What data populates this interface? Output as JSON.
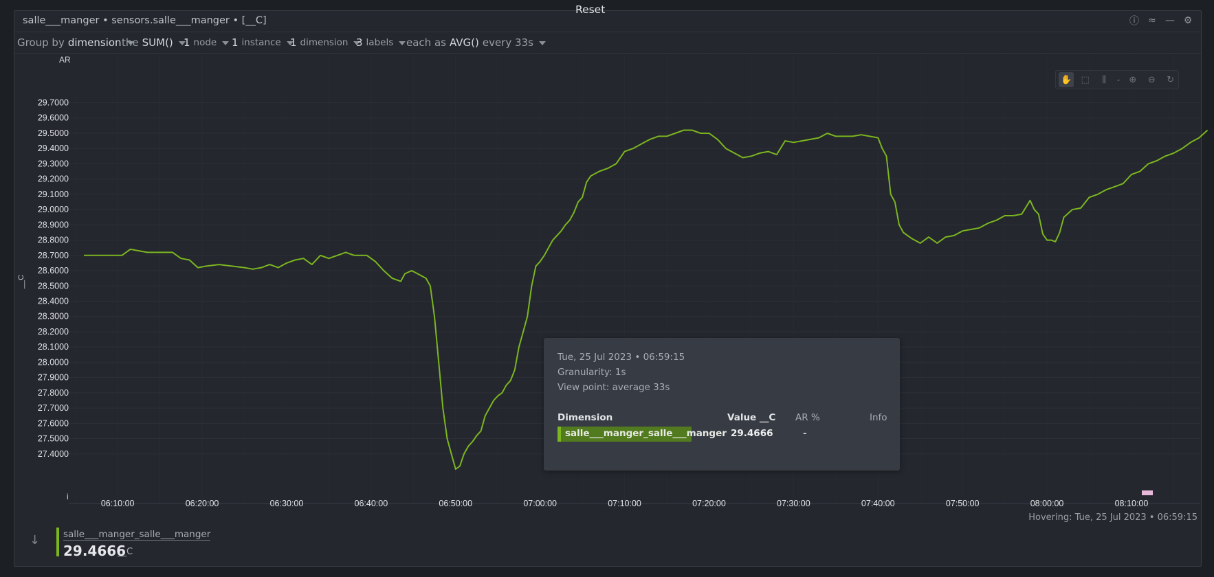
{
  "header": {
    "title": "salle___manger • sensors.salle___manger • [__C]",
    "icons": [
      "info-icon",
      "correlation-icon",
      "minimize-icon",
      "settings-icon"
    ]
  },
  "controls": {
    "group_by": {
      "prefix": "Group by",
      "value": "dimension"
    },
    "aggregate": {
      "prefix": "the",
      "value": "SUM()"
    },
    "nodes": {
      "count": "1",
      "label": "node"
    },
    "instances": {
      "count": "1",
      "label": "instance"
    },
    "dimensions": {
      "count": "1",
      "label": "dimension"
    },
    "labels": {
      "count": "3",
      "label": "labels"
    },
    "time_agg": {
      "prefix": "each as",
      "value": "AVG()",
      "suffix": "every 33s"
    },
    "reset_label": "Reset"
  },
  "chart_data": {
    "type": "line",
    "ylabel": "__C",
    "top_left_label": "AR",
    "bottom_left_label": "i",
    "ylim": [
      27.2,
      29.8
    ],
    "y_ticks": [
      "29.7000",
      "29.6000",
      "29.5000",
      "29.4000",
      "29.3000",
      "29.2000",
      "29.1000",
      "29.0000",
      "28.9000",
      "28.8000",
      "28.7000",
      "28.6000",
      "28.5000",
      "28.4000",
      "28.3000",
      "28.2000",
      "28.1000",
      "28.0000",
      "27.9000",
      "27.8000",
      "27.7000",
      "27.6000",
      "27.5000",
      "27.4000"
    ],
    "x_ticks": [
      "06:10:00",
      "06:20:00",
      "06:30:00",
      "06:40:00",
      "06:50:00",
      "07:00:00",
      "07:10:00",
      "07:20:00",
      "07:30:00",
      "07:40:00",
      "07:50:00",
      "08:00:00",
      "08:10:00"
    ],
    "x_range_minutes": [
      6.0,
      138.0
    ],
    "series": [
      {
        "name": "salle___manger_salle___manger",
        "color": "#7cb61f",
        "points": [
          [
            6.0,
            28.7
          ],
          [
            8.0,
            28.7
          ],
          [
            10.5,
            28.7
          ],
          [
            11.5,
            28.74
          ],
          [
            12.5,
            28.73
          ],
          [
            13.5,
            28.72
          ],
          [
            15.0,
            28.72
          ],
          [
            16.5,
            28.72
          ],
          [
            17.5,
            28.68
          ],
          [
            18.5,
            28.67
          ],
          [
            19.5,
            28.62
          ],
          [
            20.5,
            28.63
          ],
          [
            22.0,
            28.64
          ],
          [
            23.5,
            28.63
          ],
          [
            25.0,
            28.62
          ],
          [
            26.0,
            28.61
          ],
          [
            27.0,
            28.62
          ],
          [
            28.0,
            28.64
          ],
          [
            29.0,
            28.62
          ],
          [
            30.0,
            28.65
          ],
          [
            31.0,
            28.67
          ],
          [
            32.0,
            28.68
          ],
          [
            33.0,
            28.64
          ],
          [
            34.0,
            28.7
          ],
          [
            35.0,
            28.68
          ],
          [
            36.0,
            28.7
          ],
          [
            37.0,
            28.72
          ],
          [
            38.0,
            28.7
          ],
          [
            39.5,
            28.7
          ],
          [
            40.5,
            28.66
          ],
          [
            41.5,
            28.6
          ],
          [
            42.5,
            28.55
          ],
          [
            43.5,
            28.53
          ],
          [
            44.0,
            28.58
          ],
          [
            44.8,
            28.6
          ],
          [
            45.5,
            28.58
          ],
          [
            46.5,
            28.55
          ],
          [
            47.0,
            28.5
          ],
          [
            47.5,
            28.3
          ],
          [
            48.0,
            28.0
          ],
          [
            48.5,
            27.7
          ],
          [
            49.0,
            27.5
          ],
          [
            49.5,
            27.4
          ],
          [
            50.0,
            27.3
          ],
          [
            50.5,
            27.32
          ],
          [
            51.0,
            27.4
          ],
          [
            51.5,
            27.45
          ],
          [
            52.0,
            27.48
          ],
          [
            52.5,
            27.52
          ],
          [
            53.0,
            27.55
          ],
          [
            53.5,
            27.65
          ],
          [
            54.0,
            27.7
          ],
          [
            54.5,
            27.75
          ],
          [
            55.0,
            27.78
          ],
          [
            55.5,
            27.8
          ],
          [
            56.0,
            27.85
          ],
          [
            56.5,
            27.88
          ],
          [
            57.0,
            27.95
          ],
          [
            57.5,
            28.1
          ],
          [
            58.0,
            28.2
          ],
          [
            58.5,
            28.3
          ],
          [
            59.0,
            28.5
          ],
          [
            59.5,
            28.63
          ],
          [
            60.0,
            28.66
          ],
          [
            60.5,
            28.7
          ],
          [
            61.0,
            28.75
          ],
          [
            61.5,
            28.8
          ],
          [
            62.0,
            28.83
          ],
          [
            62.5,
            28.86
          ],
          [
            63.0,
            28.9
          ],
          [
            63.5,
            28.93
          ],
          [
            64.0,
            28.98
          ],
          [
            64.5,
            29.05
          ],
          [
            65.0,
            29.08
          ],
          [
            65.5,
            29.18
          ],
          [
            66.0,
            29.22
          ],
          [
            67.0,
            29.25
          ],
          [
            68.0,
            29.27
          ],
          [
            69.0,
            29.3
          ],
          [
            70.0,
            29.38
          ],
          [
            71.0,
            29.4
          ],
          [
            72.0,
            29.43
          ],
          [
            73.0,
            29.46
          ],
          [
            74.0,
            29.48
          ],
          [
            75.0,
            29.48
          ],
          [
            76.0,
            29.5
          ],
          [
            77.0,
            29.52
          ],
          [
            78.0,
            29.52
          ],
          [
            79.0,
            29.5
          ],
          [
            80.0,
            29.5
          ],
          [
            81.0,
            29.46
          ],
          [
            82.0,
            29.4
          ],
          [
            83.0,
            29.37
          ],
          [
            84.0,
            29.34
          ],
          [
            85.0,
            29.35
          ],
          [
            86.0,
            29.37
          ],
          [
            87.0,
            29.38
          ],
          [
            88.0,
            29.36
          ],
          [
            89.0,
            29.45
          ],
          [
            90.0,
            29.44
          ],
          [
            91.0,
            29.45
          ],
          [
            92.0,
            29.46
          ],
          [
            93.0,
            29.47
          ],
          [
            94.0,
            29.5
          ],
          [
            95.0,
            29.48
          ],
          [
            96.0,
            29.48
          ],
          [
            97.0,
            29.48
          ],
          [
            98.0,
            29.49
          ],
          [
            99.0,
            29.48
          ],
          [
            100.0,
            29.47
          ],
          [
            100.5,
            29.4
          ],
          [
            101.0,
            29.35
          ],
          [
            101.5,
            29.1
          ],
          [
            102.0,
            29.05
          ],
          [
            102.5,
            28.9
          ],
          [
            103.0,
            28.85
          ],
          [
            104.0,
            28.81
          ],
          [
            105.0,
            28.78
          ],
          [
            106.0,
            28.82
          ],
          [
            107.0,
            28.78
          ],
          [
            108.0,
            28.82
          ],
          [
            109.0,
            28.83
          ],
          [
            110.0,
            28.86
          ],
          [
            111.0,
            28.87
          ],
          [
            112.0,
            28.88
          ],
          [
            113.0,
            28.91
          ],
          [
            114.0,
            28.93
          ],
          [
            115.0,
            28.96
          ],
          [
            116.0,
            28.96
          ],
          [
            117.0,
            28.97
          ],
          [
            118.0,
            29.06
          ],
          [
            118.5,
            29.0
          ],
          [
            119.0,
            28.97
          ],
          [
            119.5,
            28.84
          ],
          [
            120.0,
            28.8
          ],
          [
            120.5,
            28.8
          ],
          [
            121.0,
            28.79
          ],
          [
            121.5,
            28.85
          ],
          [
            122.0,
            28.95
          ],
          [
            123.0,
            29.0
          ],
          [
            124.0,
            29.01
          ],
          [
            125.0,
            29.08
          ],
          [
            126.0,
            29.1
          ],
          [
            127.0,
            29.13
          ],
          [
            128.0,
            29.15
          ],
          [
            129.0,
            29.17
          ],
          [
            130.0,
            29.23
          ],
          [
            131.0,
            29.25
          ],
          [
            132.0,
            29.3
          ],
          [
            133.0,
            29.32
          ],
          [
            134.0,
            29.35
          ],
          [
            135.0,
            29.37
          ],
          [
            136.0,
            29.4
          ],
          [
            137.0,
            29.44
          ],
          [
            138.0,
            29.47
          ],
          [
            139.0,
            29.52
          ],
          [
            140.0,
            29.5
          ],
          [
            141.0,
            29.54
          ],
          [
            142.0,
            29.56
          ],
          [
            143.0,
            29.58
          ],
          [
            144.0,
            29.6
          ],
          [
            145.0,
            29.63
          ],
          [
            146.0,
            29.64
          ],
          [
            147.0,
            29.65
          ],
          [
            148.0,
            29.67
          ],
          [
            149.0,
            29.7
          ],
          [
            150.0,
            29.71
          ],
          [
            151.0,
            29.7
          ],
          [
            153.0,
            29.72
          ],
          [
            154.0,
            29.76
          ],
          [
            155.0,
            29.77
          ],
          [
            156.0,
            29.79
          ],
          [
            158.0,
            29.81
          ],
          [
            160.0,
            29.83
          ]
        ]
      }
    ]
  },
  "tooltip": {
    "timestamp": "Tue, 25 Jul 2023 • 06:59:15",
    "granularity": "Granularity: 1s",
    "view_point": "View point: average 33s",
    "col_dimension": "Dimension",
    "col_value": "Value __C",
    "col_ar": "AR %",
    "col_info": "Info",
    "row_dimension": "salle___manger_salle___manger",
    "row_value": "29.4666",
    "row_ar": "-"
  },
  "footer": {
    "hovering": "Hovering: Tue, 25 Jul 2023 • 06:59:15",
    "legend_name": "salle___manger_salle___manger",
    "legend_value": "29.4666",
    "legend_unit": "__C"
  }
}
